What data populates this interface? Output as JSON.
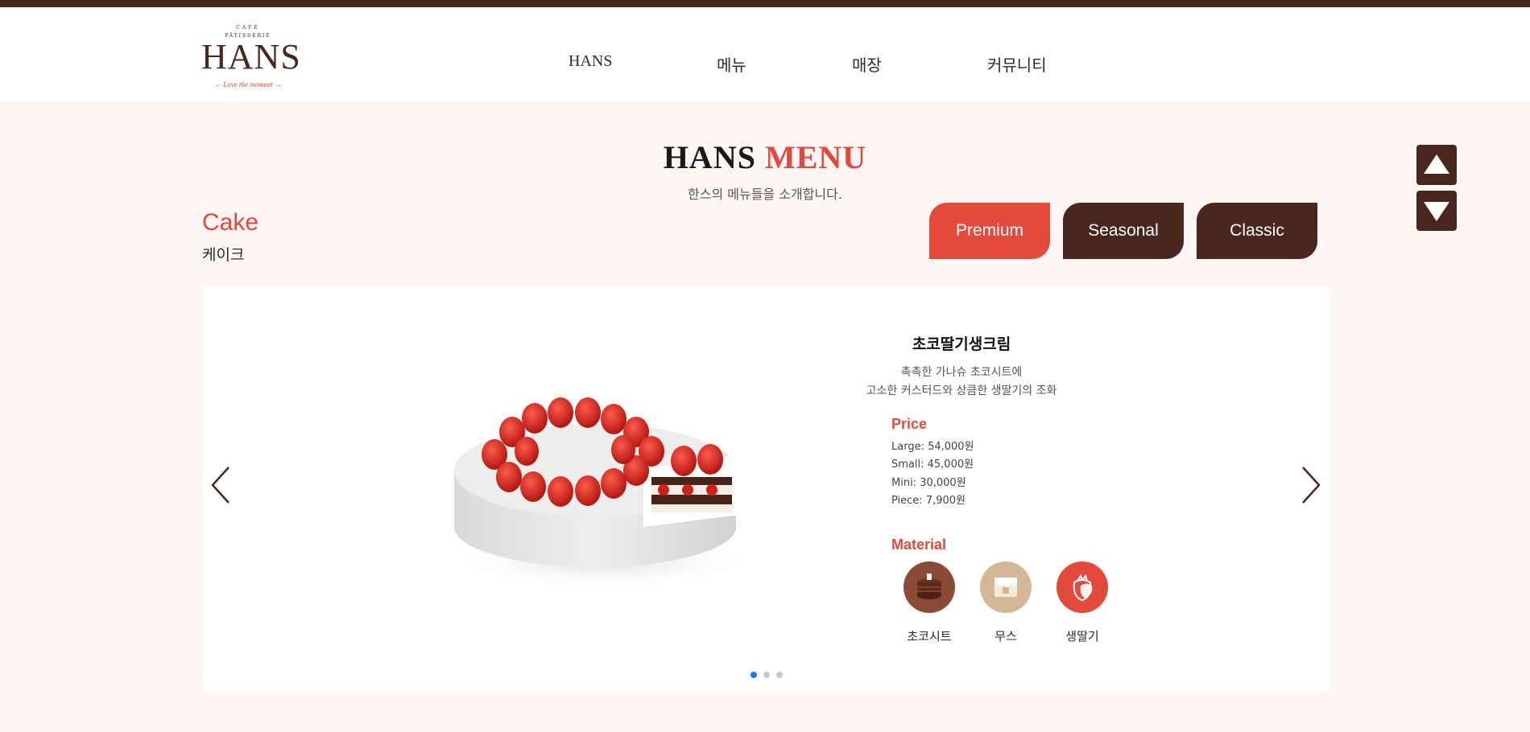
{
  "header": {
    "logo": {
      "top_text": "CAFE",
      "arc_text": "PÂTISSERIE",
      "main": "HANS",
      "tagline": "←  Love the moment  →"
    },
    "nav": [
      "HANS",
      "메뉴",
      "매장",
      "커뮤니티"
    ]
  },
  "section": {
    "title_part1": "HANS",
    "title_part2": "MENU",
    "subtitle": "한스의 메뉴들을 소개합니다."
  },
  "category": {
    "english": "Cake",
    "korean": "케이크"
  },
  "tabs": [
    {
      "label": "Premium",
      "active": true
    },
    {
      "label": "Seasonal",
      "active": false
    },
    {
      "label": "Classic",
      "active": false
    }
  ],
  "product": {
    "name": "초코딸기생크림",
    "description_line1": "촉촉한 가나슈 초코시트에",
    "description_line2": "고소한 커스터드와 상큼한 생딸기의 조화",
    "price_label": "Price",
    "prices": [
      "Large: 54,000원",
      "Small: 45,000원",
      "Mini: 30,000원",
      "Piece: 7,900원"
    ],
    "material_label": "Material",
    "materials": [
      {
        "label": "초코시트",
        "icon": "chocolate-sheet-icon",
        "color": "#8b4a35"
      },
      {
        "label": "무스",
        "icon": "mousse-icon",
        "color": "#d4b896"
      },
      {
        "label": "생딸기",
        "icon": "strawberry-icon",
        "color": "#e34a3b"
      }
    ]
  },
  "carousel": {
    "slide_count": 3,
    "active_index": 0
  },
  "colors": {
    "brand_brown": "#4a271c",
    "accent_red": "#e34a3b",
    "background": "#fdf6f5",
    "dot_active": "#1677ff"
  }
}
